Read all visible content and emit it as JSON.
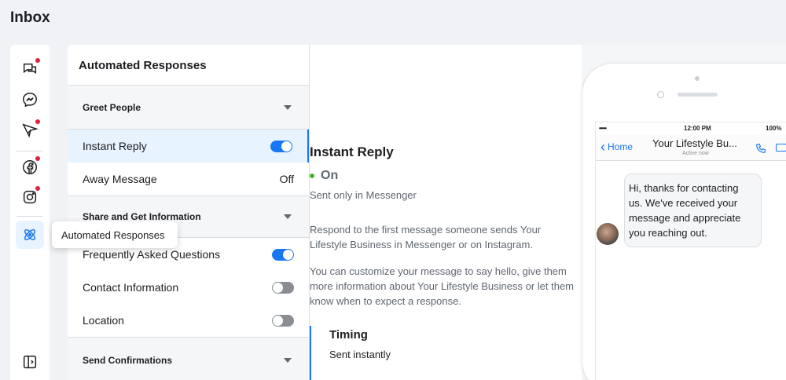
{
  "page": {
    "title": "Inbox"
  },
  "rail": {
    "items": [
      {
        "name": "comments-icon",
        "badge": true
      },
      {
        "name": "messenger-icon",
        "badge": false
      },
      {
        "name": "send-icon",
        "badge": true
      },
      {
        "name": "facebook-icon",
        "badge": true
      },
      {
        "name": "instagram-icon",
        "badge": true
      },
      {
        "name": "automation-icon",
        "badge": false,
        "active": true
      },
      {
        "name": "sidebar-toggle-icon",
        "badge": false
      }
    ],
    "tooltip": "Automated Responses"
  },
  "left": {
    "title": "Automated Responses",
    "sections": [
      {
        "label": "Greet People",
        "items": [
          {
            "label": "Instant Reply",
            "state": "on",
            "selected": true
          },
          {
            "label": "Away Message",
            "state_text": "Off"
          }
        ]
      },
      {
        "label": "Share and Get Information",
        "items": [
          {
            "label": "Frequently Asked Questions",
            "state": "on"
          },
          {
            "label": "Contact Information",
            "state": "off"
          },
          {
            "label": "Location",
            "state": "off"
          }
        ]
      },
      {
        "label": "Send Confirmations",
        "items": []
      }
    ]
  },
  "detail": {
    "title": "Instant Reply",
    "status": "On",
    "subtitle": "Sent only in Messenger",
    "para1": "Respond to the first message someone sends Your Lifestyle Business in Messenger or on Instagram.",
    "para2": "You can customize your message to say hello, give them more information about Your Lifestyle Business or let them know when to expect a response.",
    "timing_label": "Timing",
    "timing_value": "Sent instantly"
  },
  "preview": {
    "signal": "•••••",
    "time": "12:00 PM",
    "battery": "100%",
    "back_label": "Home",
    "chat_name": "Your Lifestyle Bu...",
    "chat_status": "Active now",
    "message": "Hi, thanks for contacting us. We've received your message and appreciate you reaching out."
  },
  "colors": {
    "accent": "#1877f2",
    "status_on": "#42b72a",
    "badge": "#e41e3f"
  }
}
